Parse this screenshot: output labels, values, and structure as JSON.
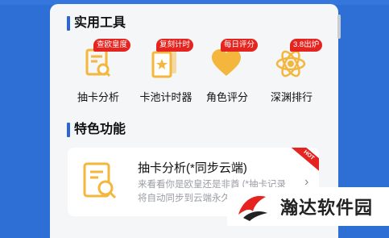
{
  "sections": {
    "tools_title": "实用工具",
    "features_title": "特色功能"
  },
  "tools": [
    {
      "label": "抽卡分析",
      "badge": "查欧皇度",
      "icon": "report-search-icon"
    },
    {
      "label": "卡池计时器",
      "badge": "复刻计时",
      "icon": "card-star-icon"
    },
    {
      "label": "角色评分",
      "badge": "每日评分",
      "icon": "heart-icon"
    },
    {
      "label": "深渊排行",
      "badge": "3.8出炉",
      "icon": "atom-icon"
    }
  ],
  "feature": {
    "title": "抽卡分析(*同步云端)",
    "description": "来看看你是欧皇还是非酋 (*抽卡记录将自动同步到云端永久",
    "hot_tag": "HOT",
    "icon": "report-search-icon"
  },
  "watermark": {
    "text": "瀚达软件园",
    "icon": "watermark-logo-icon"
  },
  "colors": {
    "accent": "#2a66d9",
    "icon": "#f4b63c",
    "badge": "#e5241f"
  }
}
